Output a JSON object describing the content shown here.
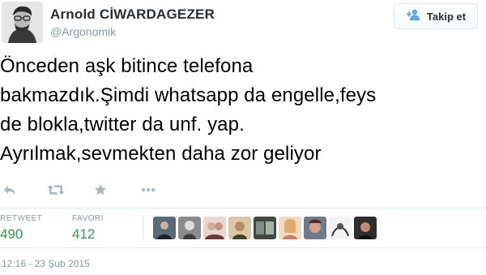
{
  "user": {
    "full_name": "Arnold CİWARDAGEZER",
    "screen_name": "@Argonomik",
    "avatar": "avatar-image"
  },
  "follow_button": {
    "label": "Takip et",
    "icon": "person-plus-icon"
  },
  "tweet": {
    "lines": [
      "Önceden aşk bitince telefona",
      "bakmazdık.Şimdi whatsapp da engelle,feys",
      "de blokla,twitter da unf. yap.",
      "Ayrılmak,sevmekten daha zor geliyor"
    ]
  },
  "actions": {
    "icons": [
      "reply-icon",
      "retweet-icon",
      "favorite-icon",
      "more-icon"
    ]
  },
  "stats": {
    "retweet_label": "RETWEET",
    "retweet_count": "490",
    "favorite_label": "FAVORİ",
    "favorite_count": "412"
  },
  "favoriters": {
    "count_shown": 9
  },
  "timestamp": "12:16 - 23 Şub 2015",
  "colors": {
    "accent": "#55acee",
    "count": "#2a9d4a",
    "muted": "#8899a6",
    "icon": "#aab8c2"
  }
}
